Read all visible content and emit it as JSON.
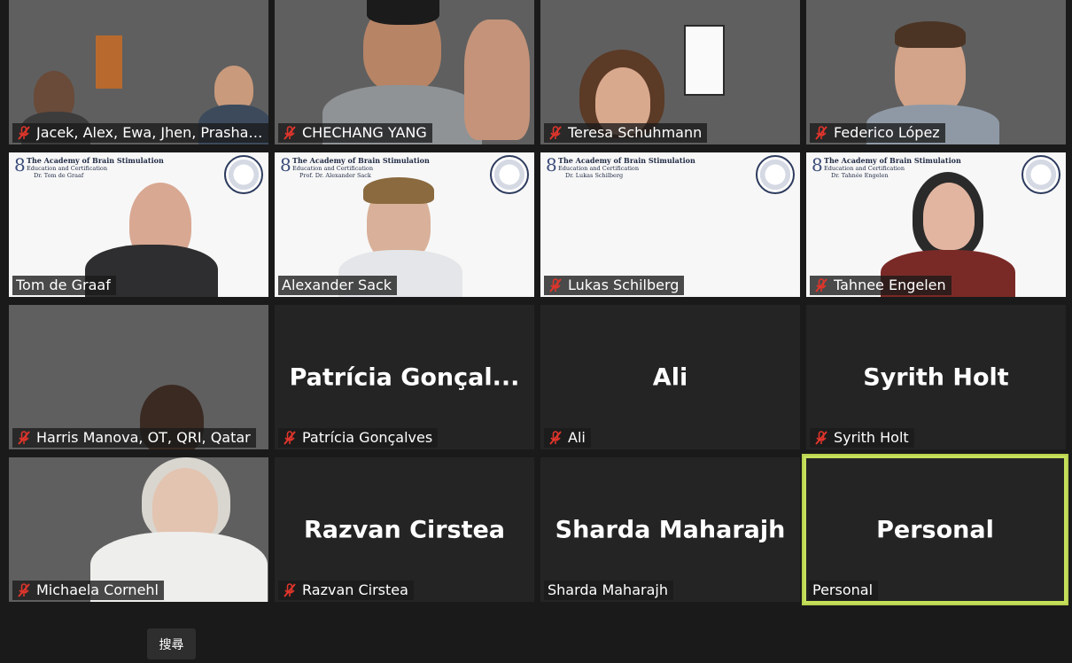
{
  "tiles": [
    {
      "label": "Jacek, Alex, Ewa, Jhen, Prashanth (...",
      "muted": true
    },
    {
      "label": "CHECHANG YANG",
      "muted": true
    },
    {
      "label": "Teresa Schuhmann",
      "muted": true
    },
    {
      "label": "Federico López",
      "muted": true
    },
    {
      "label": "Tom de Graaf",
      "muted": false,
      "slide_name": "Dr. Tom de Graaf"
    },
    {
      "label": "Alexander Sack",
      "muted": false,
      "slide_name": "Prof. Dr. Alexander Sack"
    },
    {
      "label": "Lukas Schilberg",
      "muted": true,
      "slide_name": "Dr. Lukas Schilberg"
    },
    {
      "label": "Tahnee Engelen",
      "muted": true,
      "slide_name": "Dr. Tahnée Engelen"
    },
    {
      "label": "Harris Manova, OT, QRI, Qatar",
      "muted": true
    },
    {
      "label": "Patrícia Gonçalves",
      "muted": true,
      "display_name": "Patrícia  Gonçal..."
    },
    {
      "label": "Ali",
      "muted": true,
      "display_name": "Ali"
    },
    {
      "label": "Syrith Holt",
      "muted": true,
      "display_name": "Syrith Holt"
    },
    {
      "label": "Michaela Cornehl",
      "muted": true
    },
    {
      "label": "Razvan Cirstea",
      "muted": true,
      "display_name": "Razvan Cirstea"
    },
    {
      "label": "Sharda Maharajh",
      "muted": false,
      "display_name": "Sharda Maharajh"
    },
    {
      "label": "Personal",
      "muted": false,
      "display_name": "Personal",
      "active_speaker": true
    }
  ],
  "slide": {
    "line1": "The Academy of Brain Stimulation",
    "line2": "Education and Certification"
  },
  "search_chip": "搜尋",
  "colors": {
    "active_border": "#c5e05a",
    "muted_icon": "#e0352b",
    "tile_bg": "#242424"
  }
}
